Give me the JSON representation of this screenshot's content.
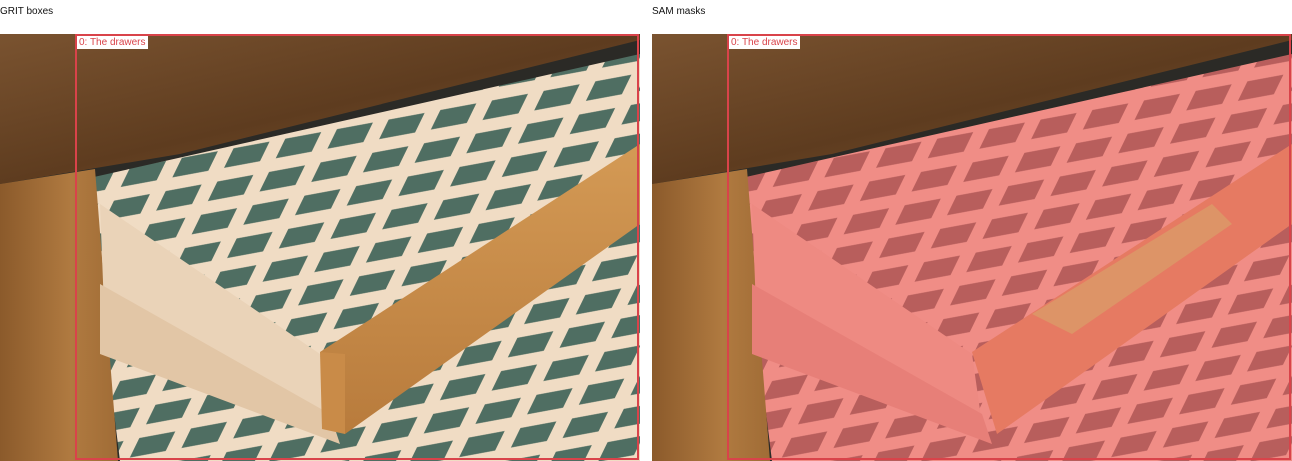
{
  "panels": {
    "left": {
      "title": "GRIT boxes",
      "box_label": "0: The drawers"
    },
    "right": {
      "title": "SAM masks",
      "box_label": "0: The drawers"
    }
  },
  "colors": {
    "box": "#d9434a",
    "mask": "#f06a6a",
    "wood_dark": "#6b4523",
    "wood_light": "#e8cdb0",
    "felt": "#4f6e62"
  }
}
